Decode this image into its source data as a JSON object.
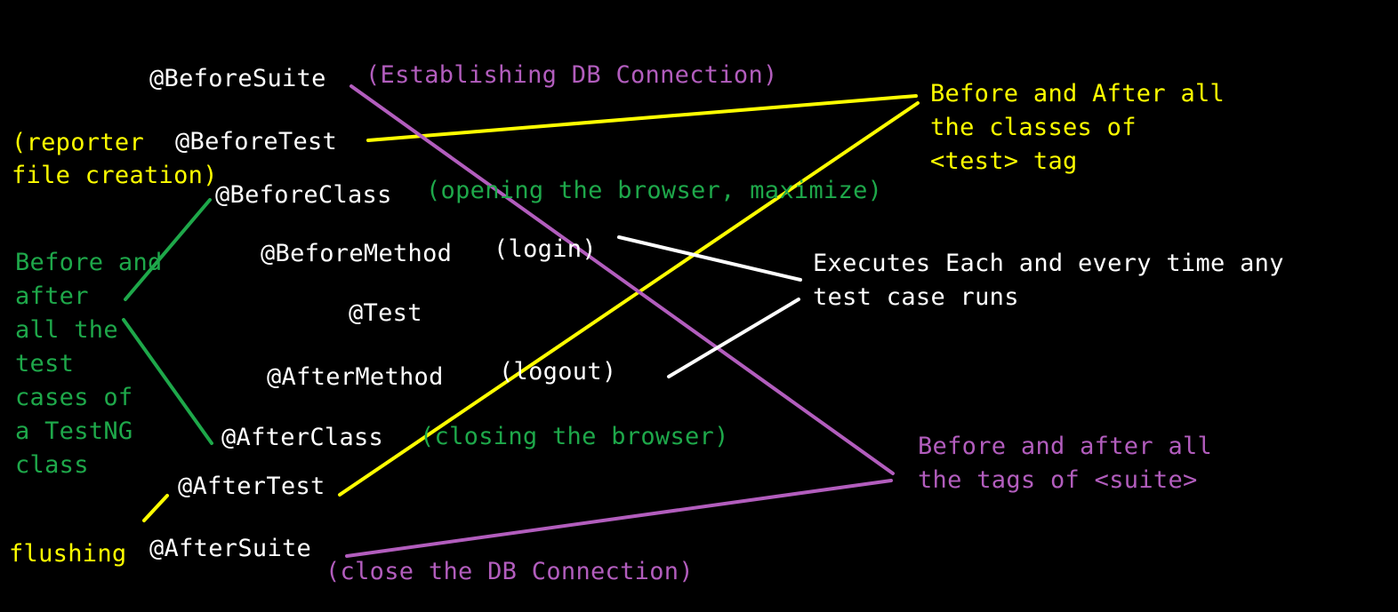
{
  "colors": {
    "background": "#000000",
    "white": "#ffffff",
    "yellow": "#ffff00",
    "purple": "#b25dbd",
    "green": "#1ea84a"
  },
  "annotations": {
    "before_suite": "@BeforeSuite",
    "before_test": "@BeforeTest",
    "before_class": "@BeforeClass",
    "before_method": "@BeforeMethod",
    "test": "@Test",
    "after_method": "@AfterMethod",
    "after_class": "@AfterClass",
    "after_test": "@AfterTest",
    "after_suite": "@AfterSuite"
  },
  "notes": {
    "establishing_db": "(Establishing DB Connection)",
    "reporter_line1": "(reporter",
    "reporter_line2": "file creation)",
    "opening_browser": "(opening the browser, maximize)",
    "login": "(login)",
    "logout": "(logout)",
    "closing_browser": "(closing the browser)",
    "flushing": "flushing",
    "close_db": "(close the DB Connection)"
  },
  "descriptions": {
    "test_tag": [
      "Before and After all",
      "the classes of",
      "<test> tag"
    ],
    "method_runs": [
      "Executes Each and every time any",
      "test case runs"
    ],
    "suite_tags": [
      "Before and after all",
      "the tags of <suite>"
    ],
    "class_cases": [
      "Before and",
      "after",
      "all the",
      "test",
      "cases of",
      "a TestNG",
      "class"
    ]
  }
}
